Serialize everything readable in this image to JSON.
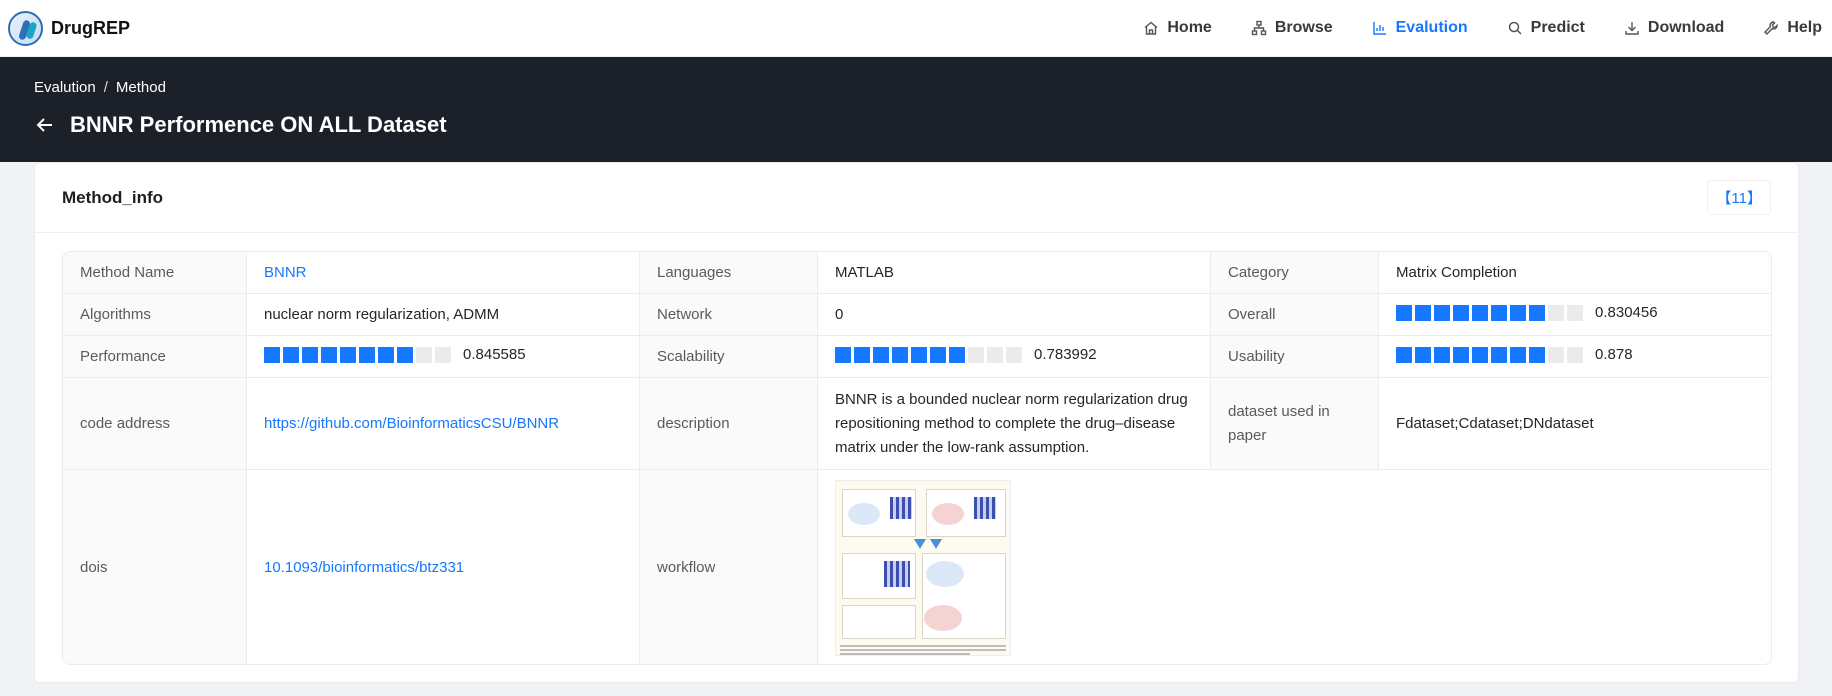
{
  "brand": {
    "name": "DrugREP"
  },
  "nav": [
    {
      "label": "Home",
      "icon": "home-icon",
      "active": false
    },
    {
      "label": "Browse",
      "icon": "sitemap-icon",
      "active": false
    },
    {
      "label": "Evalution",
      "icon": "bar-chart-icon",
      "active": true
    },
    {
      "label": "Predict",
      "icon": "search-icon",
      "active": false
    },
    {
      "label": "Download",
      "icon": "download-icon",
      "active": false
    },
    {
      "label": "Help",
      "icon": "wrench-icon",
      "active": false
    }
  ],
  "breadcrumb": {
    "items": [
      "Evalution",
      "Method"
    ],
    "separator": "/"
  },
  "page": {
    "title": "BNNR Performence ON ALL Dataset"
  },
  "card": {
    "title": "Method_info",
    "ref": "【11】"
  },
  "info": {
    "method_name_label": "Method Name",
    "method_name": "BNNR",
    "languages_label": "Languages",
    "languages": "MATLAB",
    "category_label": "Category",
    "category": "Matrix Completion",
    "algorithms_label": "Algorithms",
    "algorithms": "nuclear norm regularization, ADMM",
    "network_label": "Network",
    "network": "0",
    "overall_label": "Overall",
    "overall": "0.830456",
    "performance_label": "Performance",
    "performance": "0.845585",
    "scalability_label": "Scalability",
    "scalability": "0.783992",
    "usability_label": "Usability",
    "usability": "0.878",
    "code_address_label": "code address",
    "code_address": "https://github.com/BioinformaticsCSU/BNNR",
    "description_label": "description",
    "description": "BNNR is a bounded nuclear norm regularization drug repositioning method to complete the drug–disease matrix under the low-rank assumption.",
    "dataset_label": "dataset used in paper",
    "dataset": "Fdataset;Cdataset;DNdataset",
    "dois_label": "dois",
    "dois": "10.1093/bioinformatics/btz331",
    "workflow_label": "workflow"
  },
  "colors": {
    "accent": "#1677ff",
    "header_bg": "#1c2029",
    "meter_off": "#ebebeb"
  }
}
